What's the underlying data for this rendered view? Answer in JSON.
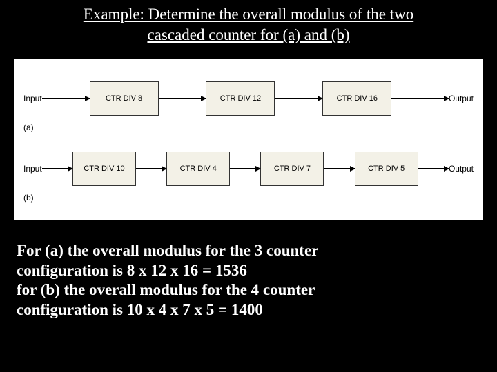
{
  "title_line1": "Example: Determine the overall modulus of the two",
  "title_line2": "cascaded counter for (a) and (b)",
  "diagram": {
    "input_label": "Input",
    "output_label": "Output",
    "a": {
      "part": "(a)",
      "blocks": [
        "CTR DIV 8",
        "CTR DIV 12",
        "CTR DIV 16"
      ]
    },
    "b": {
      "part": "(b)",
      "blocks": [
        "CTR DIV 10",
        "CTR DIV 4",
        "CTR DIV 7",
        "CTR DIV 5"
      ]
    }
  },
  "answer": {
    "line1": "For (a) the overall modulus for the 3 counter",
    "line2": "configuration is 8 x 12 x 16 = 1536",
    "line3": "for (b) the overall modulus for the 4 counter",
    "line4": "configuration is 10 x 4 x 7 x 5 = 1400"
  },
  "chart_data": [
    {
      "type": "diagram",
      "part": "a",
      "input": "Input",
      "output": "Output",
      "stages": [
        {
          "label": "CTR DIV 8",
          "modulus": 8
        },
        {
          "label": "CTR DIV 12",
          "modulus": 12
        },
        {
          "label": "CTR DIV 16",
          "modulus": 16
        }
      ],
      "overall_modulus": 1536
    },
    {
      "type": "diagram",
      "part": "b",
      "input": "Input",
      "output": "Output",
      "stages": [
        {
          "label": "CTR DIV 10",
          "modulus": 10
        },
        {
          "label": "CTR DIV 4",
          "modulus": 4
        },
        {
          "label": "CTR DIV 7",
          "modulus": 7
        },
        {
          "label": "CTR DIV 5",
          "modulus": 5
        }
      ],
      "overall_modulus": 1400
    }
  ]
}
